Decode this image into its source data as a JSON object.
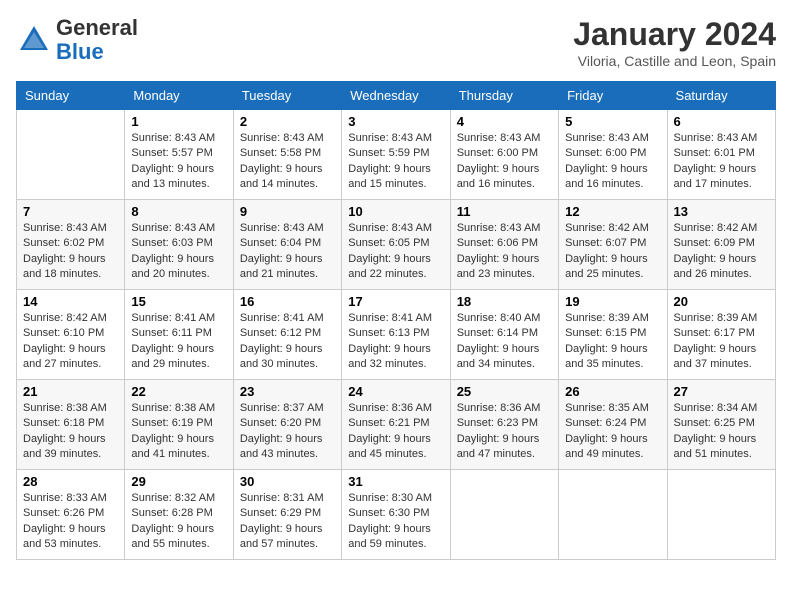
{
  "header": {
    "logo_general": "General",
    "logo_blue": "Blue",
    "month_year": "January 2024",
    "location": "Viloria, Castille and Leon, Spain"
  },
  "days_of_week": [
    "Sunday",
    "Monday",
    "Tuesday",
    "Wednesday",
    "Thursday",
    "Friday",
    "Saturday"
  ],
  "weeks": [
    [
      {
        "day": "",
        "info": ""
      },
      {
        "day": "1",
        "info": "Sunrise: 8:43 AM\nSunset: 5:57 PM\nDaylight: 9 hours\nand 13 minutes."
      },
      {
        "day": "2",
        "info": "Sunrise: 8:43 AM\nSunset: 5:58 PM\nDaylight: 9 hours\nand 14 minutes."
      },
      {
        "day": "3",
        "info": "Sunrise: 8:43 AM\nSunset: 5:59 PM\nDaylight: 9 hours\nand 15 minutes."
      },
      {
        "day": "4",
        "info": "Sunrise: 8:43 AM\nSunset: 6:00 PM\nDaylight: 9 hours\nand 16 minutes."
      },
      {
        "day": "5",
        "info": "Sunrise: 8:43 AM\nSunset: 6:00 PM\nDaylight: 9 hours\nand 16 minutes."
      },
      {
        "day": "6",
        "info": "Sunrise: 8:43 AM\nSunset: 6:01 PM\nDaylight: 9 hours\nand 17 minutes."
      }
    ],
    [
      {
        "day": "7",
        "info": "Sunrise: 8:43 AM\nSunset: 6:02 PM\nDaylight: 9 hours\nand 18 minutes."
      },
      {
        "day": "8",
        "info": "Sunrise: 8:43 AM\nSunset: 6:03 PM\nDaylight: 9 hours\nand 20 minutes."
      },
      {
        "day": "9",
        "info": "Sunrise: 8:43 AM\nSunset: 6:04 PM\nDaylight: 9 hours\nand 21 minutes."
      },
      {
        "day": "10",
        "info": "Sunrise: 8:43 AM\nSunset: 6:05 PM\nDaylight: 9 hours\nand 22 minutes."
      },
      {
        "day": "11",
        "info": "Sunrise: 8:43 AM\nSunset: 6:06 PM\nDaylight: 9 hours\nand 23 minutes."
      },
      {
        "day": "12",
        "info": "Sunrise: 8:42 AM\nSunset: 6:07 PM\nDaylight: 9 hours\nand 25 minutes."
      },
      {
        "day": "13",
        "info": "Sunrise: 8:42 AM\nSunset: 6:09 PM\nDaylight: 9 hours\nand 26 minutes."
      }
    ],
    [
      {
        "day": "14",
        "info": "Sunrise: 8:42 AM\nSunset: 6:10 PM\nDaylight: 9 hours\nand 27 minutes."
      },
      {
        "day": "15",
        "info": "Sunrise: 8:41 AM\nSunset: 6:11 PM\nDaylight: 9 hours\nand 29 minutes."
      },
      {
        "day": "16",
        "info": "Sunrise: 8:41 AM\nSunset: 6:12 PM\nDaylight: 9 hours\nand 30 minutes."
      },
      {
        "day": "17",
        "info": "Sunrise: 8:41 AM\nSunset: 6:13 PM\nDaylight: 9 hours\nand 32 minutes."
      },
      {
        "day": "18",
        "info": "Sunrise: 8:40 AM\nSunset: 6:14 PM\nDaylight: 9 hours\nand 34 minutes."
      },
      {
        "day": "19",
        "info": "Sunrise: 8:39 AM\nSunset: 6:15 PM\nDaylight: 9 hours\nand 35 minutes."
      },
      {
        "day": "20",
        "info": "Sunrise: 8:39 AM\nSunset: 6:17 PM\nDaylight: 9 hours\nand 37 minutes."
      }
    ],
    [
      {
        "day": "21",
        "info": "Sunrise: 8:38 AM\nSunset: 6:18 PM\nDaylight: 9 hours\nand 39 minutes."
      },
      {
        "day": "22",
        "info": "Sunrise: 8:38 AM\nSunset: 6:19 PM\nDaylight: 9 hours\nand 41 minutes."
      },
      {
        "day": "23",
        "info": "Sunrise: 8:37 AM\nSunset: 6:20 PM\nDaylight: 9 hours\nand 43 minutes."
      },
      {
        "day": "24",
        "info": "Sunrise: 8:36 AM\nSunset: 6:21 PM\nDaylight: 9 hours\nand 45 minutes."
      },
      {
        "day": "25",
        "info": "Sunrise: 8:36 AM\nSunset: 6:23 PM\nDaylight: 9 hours\nand 47 minutes."
      },
      {
        "day": "26",
        "info": "Sunrise: 8:35 AM\nSunset: 6:24 PM\nDaylight: 9 hours\nand 49 minutes."
      },
      {
        "day": "27",
        "info": "Sunrise: 8:34 AM\nSunset: 6:25 PM\nDaylight: 9 hours\nand 51 minutes."
      }
    ],
    [
      {
        "day": "28",
        "info": "Sunrise: 8:33 AM\nSunset: 6:26 PM\nDaylight: 9 hours\nand 53 minutes."
      },
      {
        "day": "29",
        "info": "Sunrise: 8:32 AM\nSunset: 6:28 PM\nDaylight: 9 hours\nand 55 minutes."
      },
      {
        "day": "30",
        "info": "Sunrise: 8:31 AM\nSunset: 6:29 PM\nDaylight: 9 hours\nand 57 minutes."
      },
      {
        "day": "31",
        "info": "Sunrise: 8:30 AM\nSunset: 6:30 PM\nDaylight: 9 hours\nand 59 minutes."
      },
      {
        "day": "",
        "info": ""
      },
      {
        "day": "",
        "info": ""
      },
      {
        "day": "",
        "info": ""
      }
    ]
  ]
}
